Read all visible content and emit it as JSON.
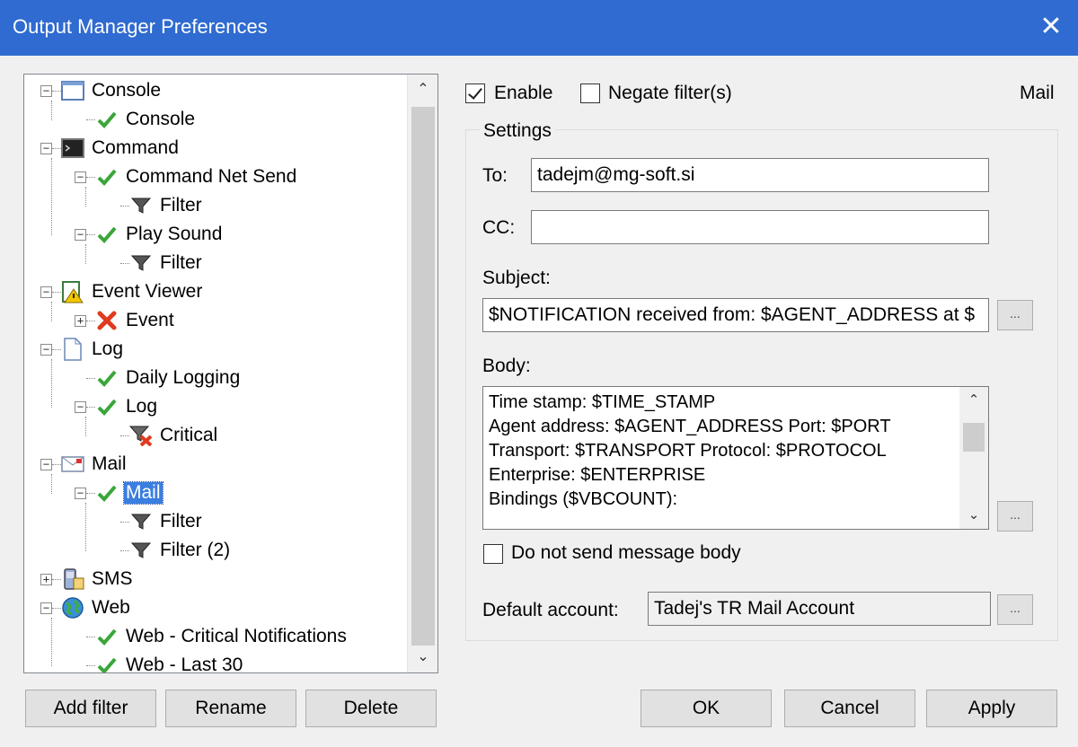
{
  "window": {
    "title": "Output Manager Preferences",
    "close_glyph": "✕"
  },
  "tree": {
    "scroll_up": "⌃",
    "scroll_down": "⌄",
    "items": [
      {
        "label": "Console",
        "icon": "console-window-icon",
        "expander": "−"
      },
      {
        "label": "Console",
        "icon": "checkmark-icon"
      },
      {
        "label": "Command",
        "icon": "command-prompt-icon",
        "expander": "−"
      },
      {
        "label": "Command Net Send",
        "icon": "checkmark-icon",
        "expander": "−"
      },
      {
        "label": "Filter",
        "icon": "funnel-icon"
      },
      {
        "label": "Play Sound",
        "icon": "checkmark-icon",
        "expander": "−"
      },
      {
        "label": "Filter",
        "icon": "funnel-icon"
      },
      {
        "label": "Event Viewer",
        "icon": "event-viewer-icon",
        "expander": "−"
      },
      {
        "label": "Event",
        "icon": "red-x-icon",
        "expander": "+"
      },
      {
        "label": "Log",
        "icon": "document-icon",
        "expander": "−"
      },
      {
        "label": "Daily Logging",
        "icon": "checkmark-icon"
      },
      {
        "label": "Log",
        "icon": "checkmark-icon",
        "expander": "−"
      },
      {
        "label": "Critical",
        "icon": "funnel-red-x-icon"
      },
      {
        "label": "Mail",
        "icon": "envelope-icon",
        "expander": "−"
      },
      {
        "label": "Mail",
        "icon": "checkmark-icon",
        "expander": "−",
        "selected": true
      },
      {
        "label": "Filter",
        "icon": "funnel-icon"
      },
      {
        "label": "Filter (2)",
        "icon": "funnel-icon"
      },
      {
        "label": "SMS",
        "icon": "sms-phone-icon",
        "expander": "+"
      },
      {
        "label": "Web",
        "icon": "globe-icon",
        "expander": "−"
      },
      {
        "label": "Web - Critical Notifications",
        "icon": "checkmark-icon"
      },
      {
        "label": "Web - Last 30",
        "icon": "checkmark-icon"
      }
    ]
  },
  "buttons": {
    "add_filter": "Add filter",
    "rename": "Rename",
    "delete": "Delete",
    "ok": "OK",
    "cancel": "Cancel",
    "apply": "Apply",
    "browse": "..."
  },
  "options": {
    "enable_label": "Enable",
    "enable_checked": true,
    "negate_label": "Negate filter(s)",
    "negate_checked": false,
    "type_label": "Mail"
  },
  "settings": {
    "group_title": "Settings",
    "to_label": "To:",
    "to_value": "tadejm@mg-soft.si",
    "cc_label": "CC:",
    "cc_value": "",
    "subject_label": "Subject:",
    "subject_value": "$NOTIFICATION received from: $AGENT_ADDRESS at $",
    "body_label": "Body:",
    "body_lines": [
      "Time stamp: $TIME_STAMP",
      "Agent address: $AGENT_ADDRESS  Port: $PORT",
      "Transport: $TRANSPORT  Protocol: $PROTOCOL",
      "Enterprise: $ENTERPRISE",
      "Bindings ($VBCOUNT):"
    ],
    "no_body_label": "Do not send message body",
    "no_body_checked": false,
    "default_account_label": "Default account:",
    "default_account_value": "Tadej's TR Mail Account"
  }
}
